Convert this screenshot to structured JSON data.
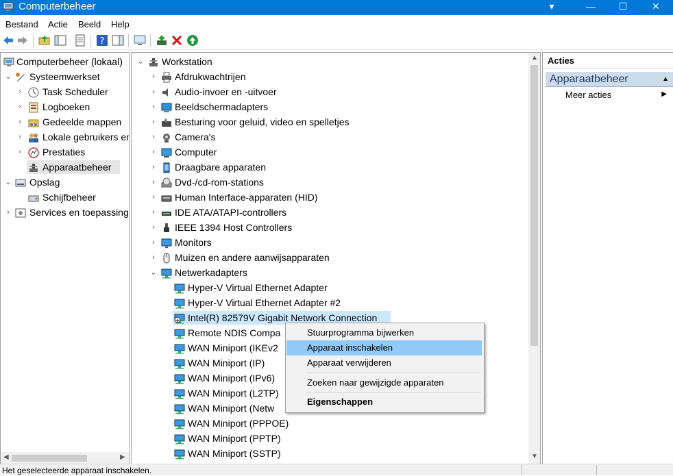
{
  "window": {
    "title": "Computerbeheer",
    "controls": {
      "pin": "▾",
      "minimize": "—",
      "maximize": "☐",
      "close": "✕"
    }
  },
  "menubar": [
    "Bestand",
    "Actie",
    "Beeld",
    "Help"
  ],
  "left_tree": {
    "root": "Computerbeheer (lokaal)",
    "systeemwerkset": "Systeemwerkset",
    "task_scheduler": "Task Scheduler",
    "logboeken": "Logboeken",
    "gedeelde_mappen": "Gedeelde mappen",
    "lokale_gebruikers": "Lokale gebruikers en groepen",
    "prestaties": "Prestaties",
    "apparaatbeheer": "Apparaatbeheer",
    "opslag": "Opslag",
    "schijfbeheer": "Schijfbeheer",
    "services": "Services en toepassingen"
  },
  "device_tree": {
    "root": "Workstation",
    "categories": [
      "Afdrukwachtrijen",
      "Audio-invoer en -uitvoer",
      "Beeldschermadapters",
      "Besturing voor geluid, video en spelletjes",
      "Camera's",
      "Computer",
      "Draagbare apparaten",
      "Dvd-/cd-rom-stations",
      "Human Interface-apparaten (HID)",
      "IDE ATA/ATAPI-controllers",
      "IEEE 1394 Host Controllers",
      "Monitors",
      "Muizen en andere aanwijsapparaten",
      "Netwerkadapters"
    ],
    "network_adapters": [
      "Hyper-V Virtual Ethernet Adapter",
      "Hyper-V Virtual Ethernet Adapter #2",
      "Intel(R) 82579V Gigabit Network Connection",
      "Remote NDIS Compa",
      "WAN Miniport (IKEv2",
      "WAN Miniport (IP)",
      "WAN Miniport (IPv6)",
      "WAN Miniport (L2TP)",
      "WAN Miniport (Netw",
      "WAN Miniport (PPPOE)",
      "WAN Miniport (PPTP)",
      "WAN Miniport (SSTP)"
    ]
  },
  "context_menu": {
    "update_driver": "Stuurprogramma bijwerken",
    "enable_device": "Apparaat inschakelen",
    "uninstall_device": "Apparaat verwijderen",
    "scan_hardware": "Zoeken naar gewijzigde apparaten",
    "properties": "Eigenschappen"
  },
  "actions_pane": {
    "title": "Acties",
    "group": "Apparaatbeheer",
    "more_actions": "Meer acties"
  },
  "statusbar": {
    "text": "Het geselecteerde apparaat inschakelen."
  },
  "colors": {
    "titlebar": "#0078d7",
    "selection": "#cce8ff",
    "menu_highlight": "#91c9f7",
    "actions_header": "#cddbea"
  }
}
